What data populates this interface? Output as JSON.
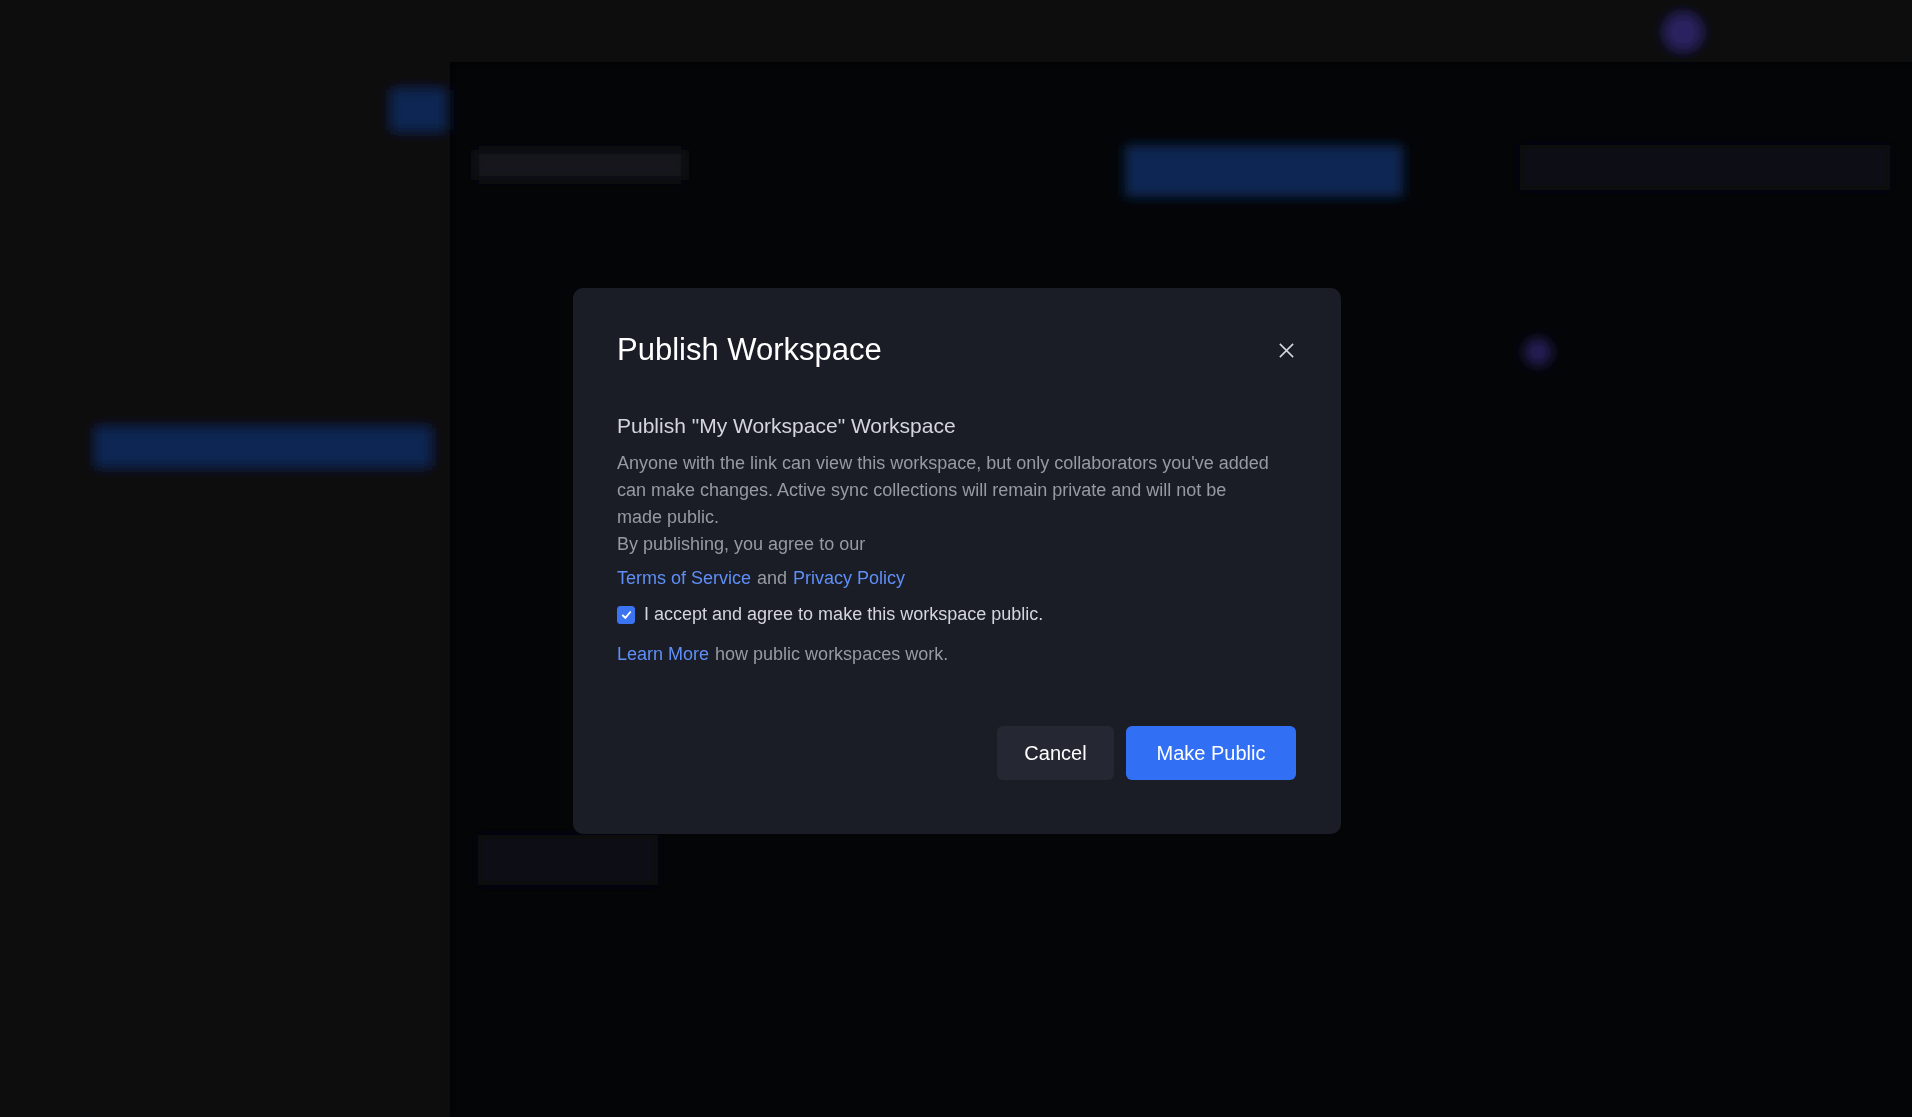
{
  "dialog": {
    "title": "Publish Workspace",
    "subtitle": "Publish \"My Workspace\" Workspace",
    "paragraphs": [
      "Anyone with the link can view this workspace, but only collaborators you've added can make changes. Active sync collections will remain private and will not be made public.",
      "By publishing, you agree to our"
    ],
    "agreement_links": {
      "first": "Terms of Service",
      "joiner": "and",
      "second": "Privacy Policy"
    },
    "consent": {
      "label": "I accept and agree to make this workspace public.",
      "checked": true
    },
    "learn_more": {
      "link": "Learn More",
      "text": "how public workspaces work."
    },
    "buttons": [
      {
        "label": "Cancel",
        "kind": "secondary"
      },
      {
        "label": "Make Public",
        "kind": "primary"
      }
    ]
  }
}
